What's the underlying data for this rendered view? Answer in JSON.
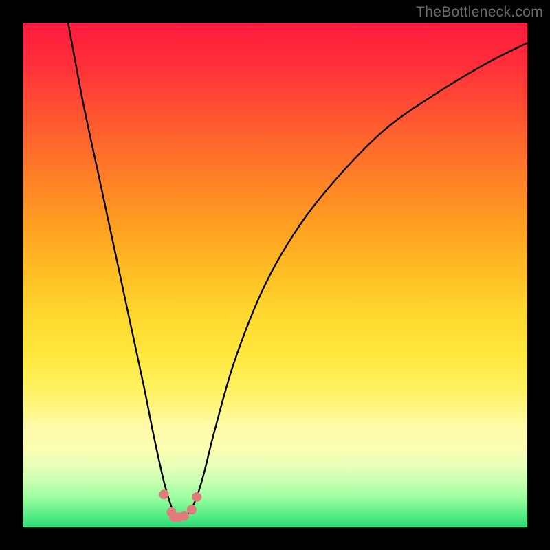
{
  "watermark": "TheBottleneck.com",
  "chart_data": {
    "type": "line",
    "title": "",
    "xlabel": "",
    "ylabel": "",
    "xlim": [
      0,
      100
    ],
    "ylim": [
      0,
      100
    ],
    "series": [
      {
        "name": "bottleneck-curve",
        "x": [
          9,
          12,
          15,
          18,
          21,
          24,
          26,
          28,
          29.5,
          30.5,
          31.5,
          33,
          34.5,
          36,
          38,
          42,
          48,
          55,
          63,
          72,
          82,
          92,
          100
        ],
        "values": [
          100,
          84,
          70,
          56,
          42,
          28,
          18,
          9,
          4,
          2,
          2,
          3,
          6,
          11,
          19,
          33,
          48,
          60,
          70,
          79,
          86,
          92,
          96
        ]
      }
    ],
    "markers": {
      "name": "trough-markers",
      "color": "#e17a7a",
      "radius_px": 7,
      "points": [
        {
          "x": 28.0,
          "y": 6.5
        },
        {
          "x": 29.5,
          "y": 3.0
        },
        {
          "x": 30.0,
          "y": 2.0
        },
        {
          "x": 31.0,
          "y": 2.0
        },
        {
          "x": 32.0,
          "y": 2.2
        },
        {
          "x": 33.5,
          "y": 3.5
        },
        {
          "x": 34.5,
          "y": 6.0
        }
      ]
    },
    "colors": {
      "curve": "#000000",
      "background_top": "#ff1a3f",
      "background_bottom": "#29db77"
    }
  }
}
